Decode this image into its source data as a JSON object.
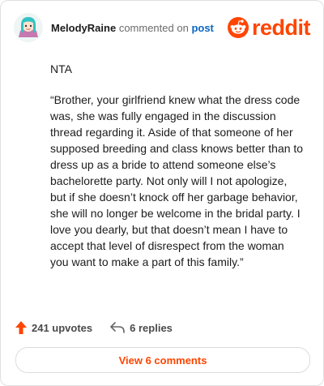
{
  "comment": {
    "author": "MelodyRaine",
    "action": "commented on",
    "post_link": "post",
    "verdict": "NTA",
    "text": "“Brother, your girlfriend knew what the dress code was, she was fully engaged in the discussion thread regarding it. Aside of that someone of her supposed breeding and class knows better than to dress up as a bride to attend someone else’s bachelorette party. Not only will I not apologize, but if she doesn’t knock off her garbage behavior, she will no longer be welcome in the bridal party. I love you dearly, but that doesn’t mean I have to accept that level of disrespect from the woman you want to make a part of this family.”"
  },
  "brand": {
    "wordmark": "reddit",
    "icon": "reddit-snoo-icon",
    "color": "#ff4500"
  },
  "stats": {
    "upvotes_label": "241 upvotes",
    "replies_label": "6 replies",
    "upvote_icon": "upvote-arrow-icon",
    "reply_icon": "reply-arrow-icon",
    "upvote_color": "#ff4500"
  },
  "footer": {
    "view_comments_label": "View 6 comments"
  }
}
